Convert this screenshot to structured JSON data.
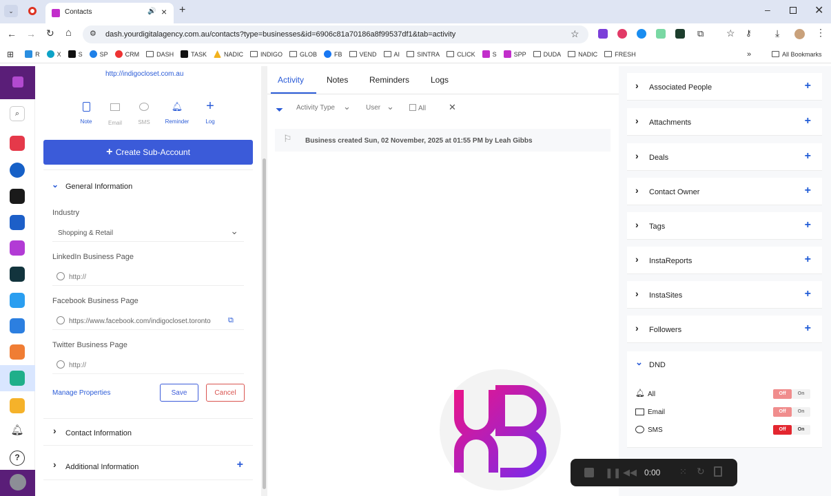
{
  "browser": {
    "tab_title": "Contacts",
    "url": "dash.yourdigitalagency.com.au/contacts?type=businesses&id=6906c81a70186a8f99537df1&tab=activity",
    "bookmarks": [
      "R",
      "X",
      "S",
      "SP",
      "CRM",
      "DASH",
      "TASK",
      "NADIC",
      "INDIGO",
      "GLOB",
      "FB",
      "VEND",
      "AI",
      "SINTRA",
      "CLICK",
      "S",
      "SPP",
      "DUDA",
      "NADIC",
      "FRESH"
    ],
    "all_bookmarks": "All Bookmarks"
  },
  "left": {
    "website": "http://indigocloset.com.au",
    "actions": [
      "Note",
      "Email",
      "SMS",
      "Reminder",
      "Log"
    ],
    "create_sub_account": "Create Sub-Account",
    "general_info": "General Information",
    "industry_label": "Industry",
    "industry_value": "Shopping & Retail",
    "linkedin_label": "LinkedIn Business Page",
    "linkedin_value": "http://",
    "facebook_label": "Facebook Business Page",
    "facebook_value": "https://www.facebook.com/indigocloset.toronto",
    "twitter_label": "Twitter Business Page",
    "twitter_value": "http://",
    "manage_properties": "Manage Properties",
    "save": "Save",
    "cancel": "Cancel",
    "contact_info": "Contact Information",
    "additional_info": "Additional Information"
  },
  "middle": {
    "tabs": [
      "Activity",
      "Notes",
      "Reminders",
      "Logs"
    ],
    "filter_activity": "Activity Type",
    "filter_user": "User",
    "filter_all": "All",
    "activity_text": "Business created Sun, 02 November, 2025 at 01:55 PM by Leah Gibbs"
  },
  "right": {
    "sections": [
      "Associated People",
      "Attachments",
      "Deals",
      "Contact Owner",
      "Tags",
      "InstaReports",
      "InstaSites",
      "Followers"
    ],
    "dnd_title": "DND",
    "dnd_rows": [
      {
        "label": "All",
        "off": "Off",
        "on": "On"
      },
      {
        "label": "Email",
        "off": "Off",
        "on": "On"
      },
      {
        "label": "SMS",
        "off": "Off",
        "on": "On"
      }
    ]
  },
  "recorder": {
    "time": "0:00"
  }
}
